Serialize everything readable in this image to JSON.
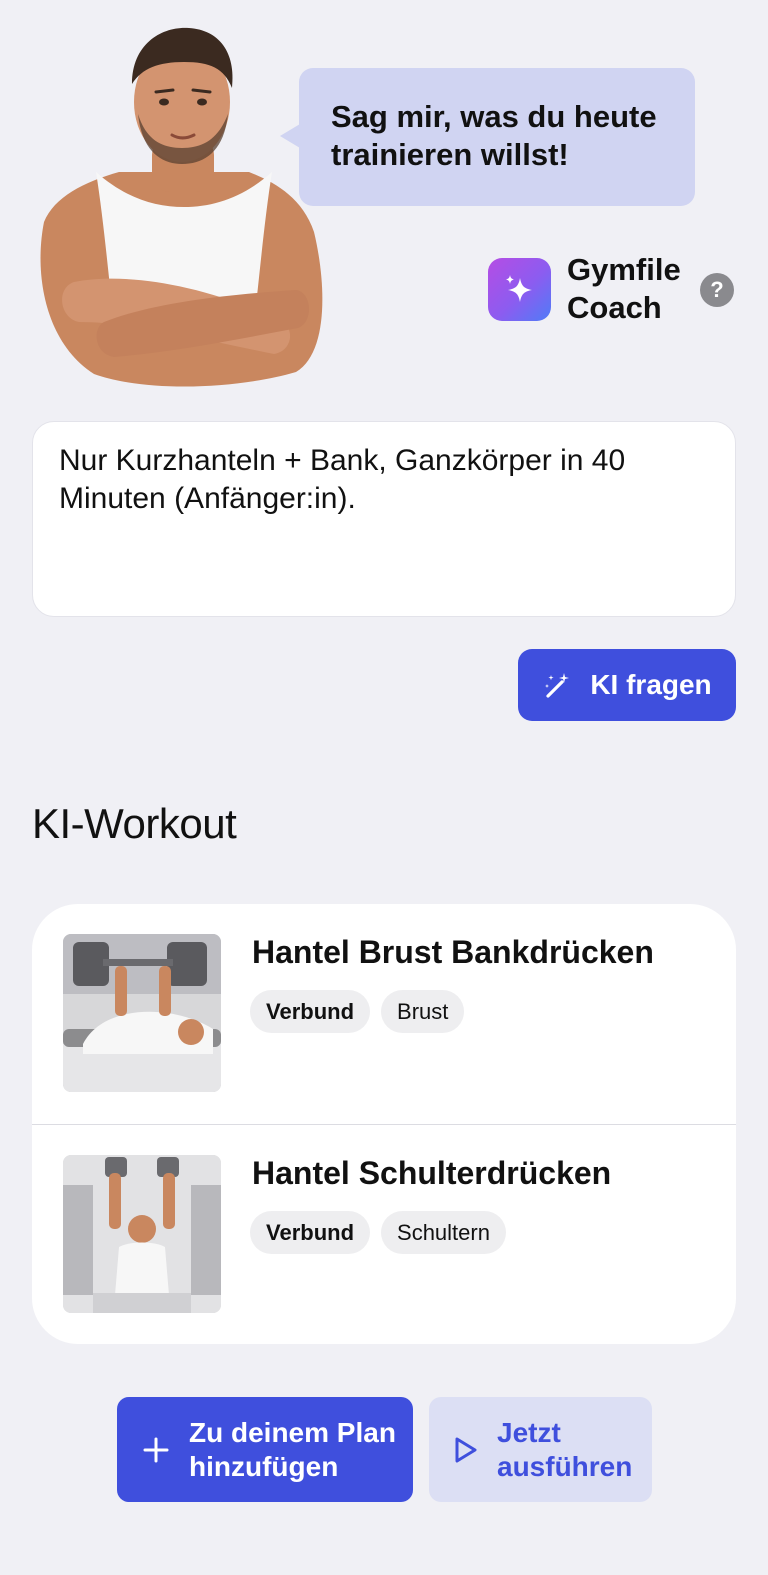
{
  "coach": {
    "speech": "Sag mir, was du heute trainieren willst!",
    "name": "Gymfile Coach",
    "help_label": "?",
    "avatar_icon": "muscular-man-portrait"
  },
  "prompt": {
    "value": "Nur Kurzhanteln + Bank, Ganzkörper in 40 Minuten (Anfänger:in).",
    "ask_label": "KI fragen",
    "ask_icon": "magic-wand-icon"
  },
  "workout": {
    "title": "KI-Workout",
    "exercises": [
      {
        "title": "Hantel Brust Bankdrücken",
        "tags": [
          "Verbund",
          "Brust"
        ],
        "image": "dumbbell-bench-press"
      },
      {
        "title": "Hantel Schulterdrücken",
        "tags": [
          "Verbund",
          "Schultern"
        ],
        "image": "dumbbell-shoulder-press"
      }
    ]
  },
  "actions": {
    "add_plan_label": "Zu deinem Plan\nhinzufügen",
    "run_now_label": "Jetzt\nausführen"
  },
  "colors": {
    "background": "#f0f0f5",
    "accent": "#3f4fdd",
    "bubble": "#d0d4f2",
    "secondary_button": "#dcdff4"
  }
}
